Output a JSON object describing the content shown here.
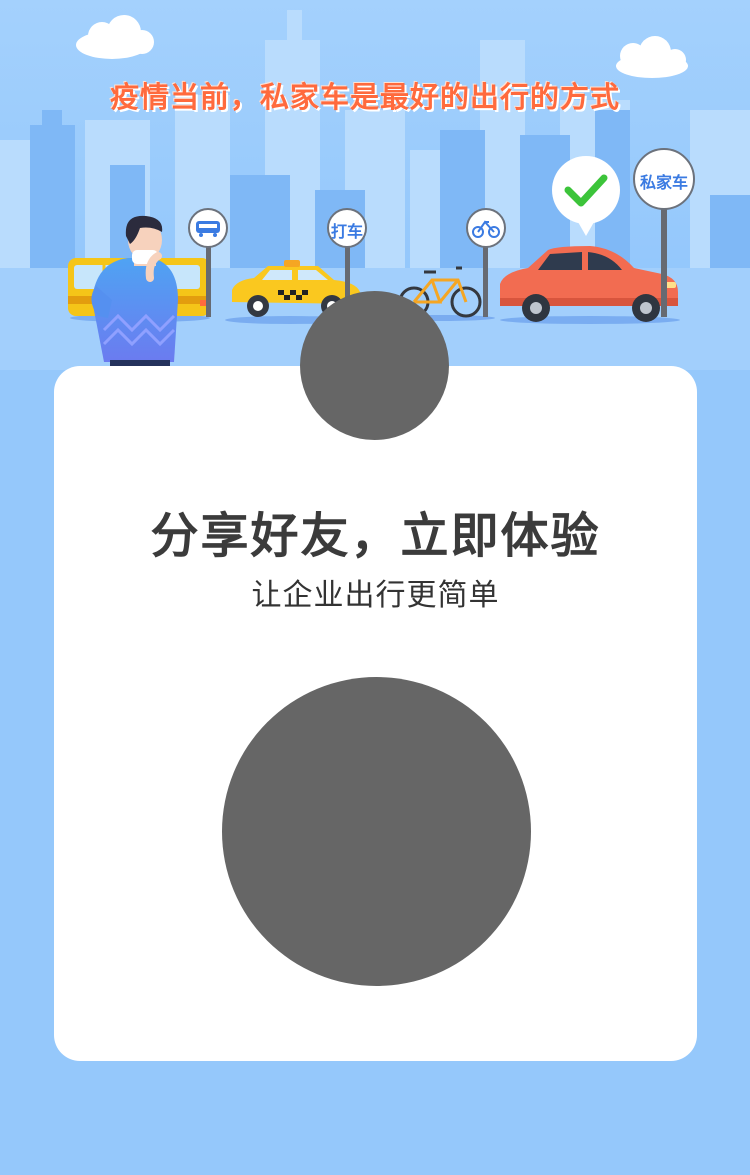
{
  "banner": {
    "title": "疫情当前，私家车是最好的出行的方式",
    "signs": {
      "taxi": "打车",
      "private_car": "私家车"
    }
  },
  "card": {
    "headline": "分享好友，立即体验",
    "subline": "让企业出行更简单"
  },
  "colors": {
    "background": "#95c8fb",
    "title_orange": "#ff6a3d",
    "sign_blue": "#3b7be2",
    "placeholder_gray": "#666666"
  },
  "icons": [
    "bus-icon",
    "bicycle-icon",
    "checkmark-icon",
    "cloud-icon"
  ]
}
